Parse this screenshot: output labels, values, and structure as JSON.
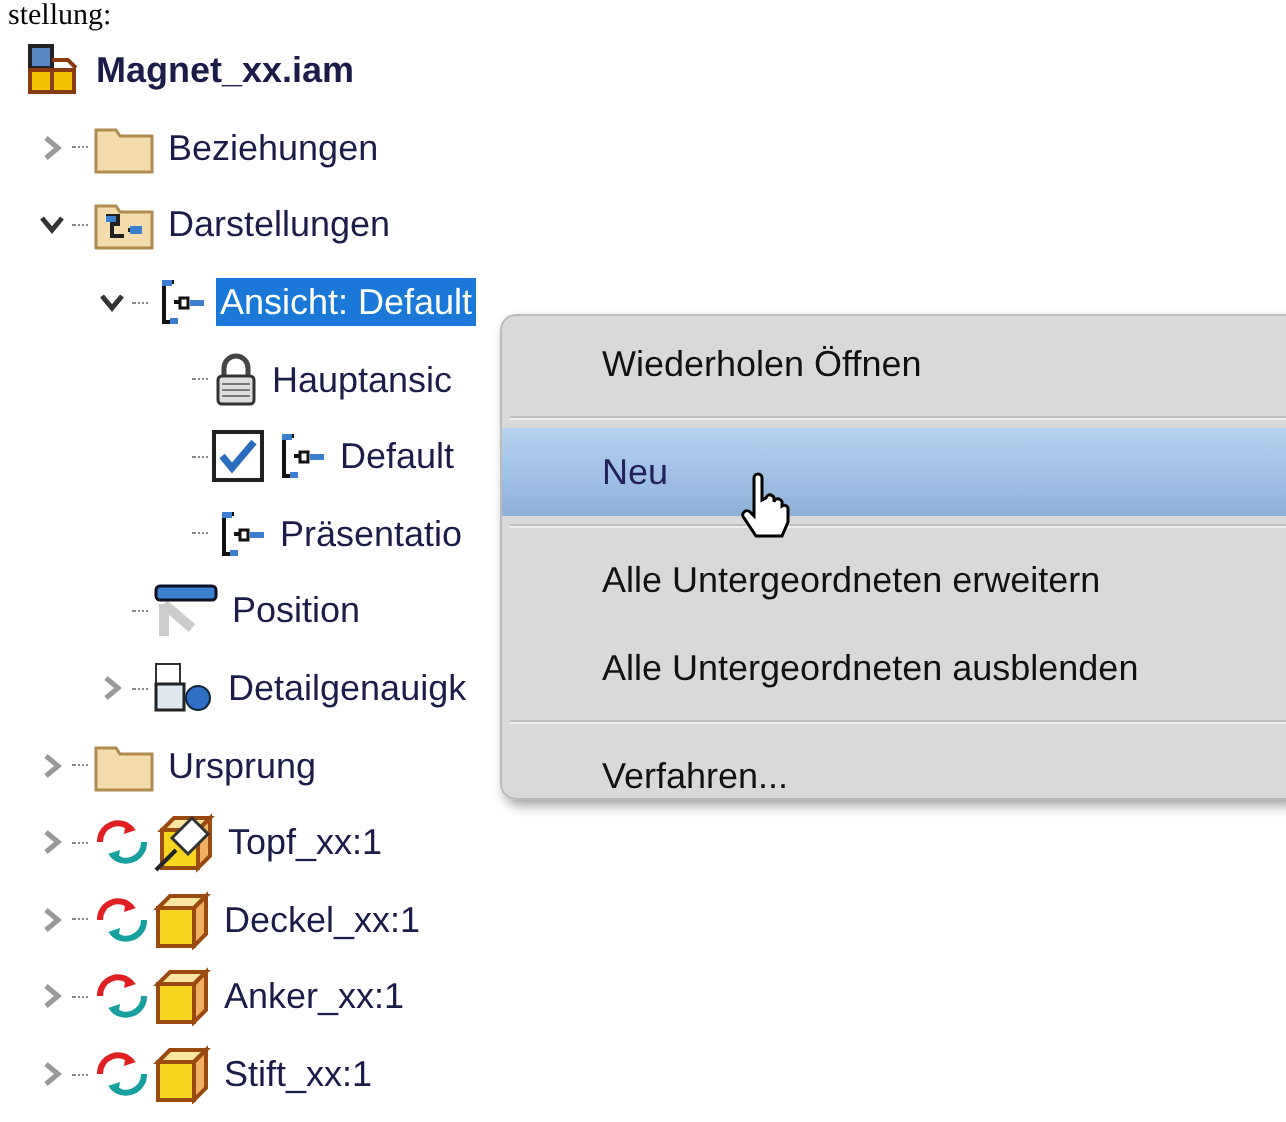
{
  "heading": "stellung:",
  "tree": {
    "label": "Magnet_xx.iam",
    "kind": "assembly",
    "selected": false,
    "children": [
      {
        "label": "Beziehungen",
        "kind": "folder",
        "expanded": false,
        "selected": false
      },
      {
        "label": "Darstellungen",
        "kind": "repfolder",
        "expanded": true,
        "selected": false,
        "children": [
          {
            "label": "Ansicht: Default",
            "kind": "view",
            "expanded": true,
            "selected": true,
            "children": [
              {
                "label": "Hauptansic",
                "kind": "lock",
                "selected": false
              },
              {
                "label": "Default",
                "kind": "view",
                "selected": false,
                "checked": true
              },
              {
                "label": "Präsentatio",
                "kind": "view",
                "selected": false
              }
            ]
          },
          {
            "label": "Position",
            "kind": "position",
            "selected": false
          },
          {
            "label": "Detailgenauigk",
            "kind": "lod",
            "expanded": false,
            "selected": false
          }
        ]
      },
      {
        "label": "Ursprung",
        "kind": "folder",
        "expanded": false,
        "selected": false
      },
      {
        "label": "Topf_xx:1",
        "kind": "pinned",
        "expanded": false,
        "selected": false,
        "out_of_date": true
      },
      {
        "label": "Deckel_xx:1",
        "kind": "part",
        "expanded": false,
        "selected": false,
        "out_of_date": true
      },
      {
        "label": "Anker_xx:1",
        "kind": "part",
        "expanded": false,
        "selected": false,
        "out_of_date": true
      },
      {
        "label": "Stift_xx:1",
        "kind": "part",
        "expanded": false,
        "selected": false,
        "out_of_date": true
      }
    ]
  },
  "context_menu": {
    "items": [
      {
        "kind": "item",
        "label": "Wiederholen Öffnen",
        "highlighted": false
      },
      {
        "kind": "separator"
      },
      {
        "kind": "item",
        "label": "Neu",
        "highlighted": true
      },
      {
        "kind": "separator"
      },
      {
        "kind": "item",
        "label": "Alle Untergeordneten erweitern",
        "highlighted": false
      },
      {
        "kind": "item",
        "label": "Alle Untergeordneten ausblenden",
        "highlighted": false
      },
      {
        "kind": "separator"
      },
      {
        "kind": "item",
        "label": "Verfahren...",
        "highlighted": false
      }
    ]
  }
}
